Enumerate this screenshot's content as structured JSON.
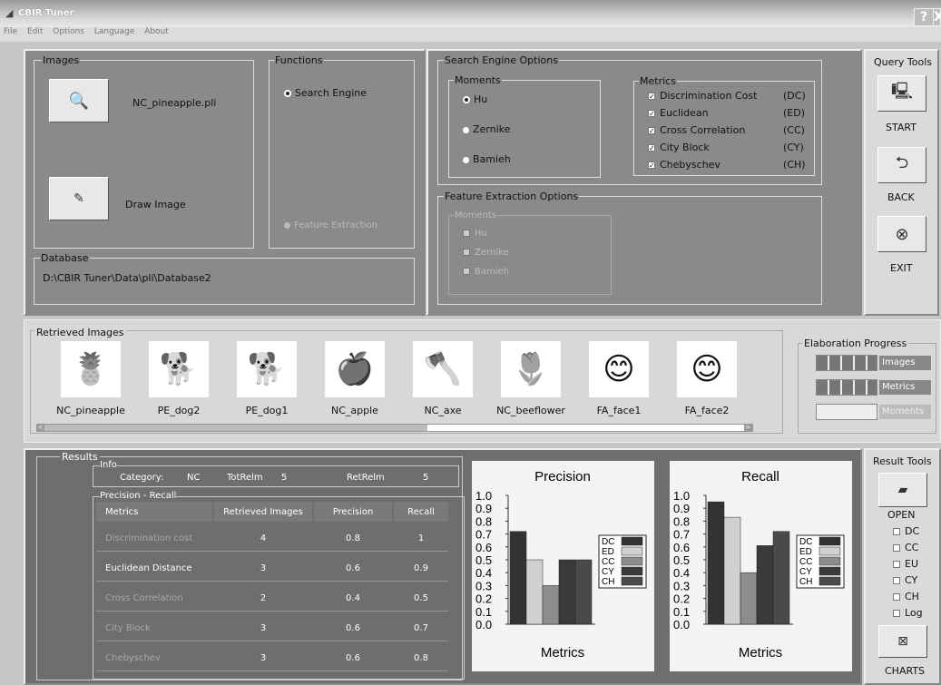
{
  "window": {
    "title": "CBIR Tuner",
    "help_label": "?",
    "close_label": "X"
  },
  "menu": [
    "File",
    "Edit",
    "Options",
    "Language",
    "About"
  ],
  "images_panel": {
    "title": "Images",
    "file_name": "NC_pineapple.pli",
    "draw_label": "Draw Image"
  },
  "functions_panel": {
    "title": "Functions",
    "search_engine": "Search Engine",
    "feature_extraction": "Feature Extraction"
  },
  "database": {
    "title": "Database",
    "path": "D:\\CBIR Tuner\\Data\\pli\\Database2"
  },
  "search_options": {
    "title": "Search Engine Options",
    "moments_title": "Moments",
    "moments": [
      "Hu",
      "Zernike",
      "Bamieh"
    ],
    "metrics_title": "Metrics",
    "metrics": [
      {
        "label": "Discrimination Cost",
        "code": "(DC)"
      },
      {
        "label": "Euclidean",
        "code": "(ED)"
      },
      {
        "label": "Cross Correlation",
        "code": "(CC)"
      },
      {
        "label": "City Block",
        "code": "(CY)"
      },
      {
        "label": "Chebyschev",
        "code": "(CH)"
      }
    ]
  },
  "feature_options": {
    "title": "Feature Extraction Options",
    "moments_title": "Moments",
    "moments": [
      "Hu",
      "Zernike",
      "Bamieh"
    ]
  },
  "query_tools": {
    "title": "Query Tools",
    "start": "START",
    "back": "BACK",
    "exit": "EXIT"
  },
  "retrieved": {
    "title": "Retrieved Images",
    "items": [
      "NC_pineapple",
      "PE_dog2",
      "PE_dog1",
      "NC_apple",
      "NC_axe",
      "NC_beeflower",
      "FA_face1",
      "FA_face2"
    ],
    "scroll_left": "<",
    "scroll_right": ">"
  },
  "progress": {
    "title": "Elaboration Progress",
    "items": [
      {
        "label": "Images",
        "value": 1.0
      },
      {
        "label": "Metrics",
        "value": 1.0
      },
      {
        "label": "Moments",
        "value": 0.0
      }
    ]
  },
  "results": {
    "title": "Results",
    "info_title": "Info",
    "category_label": "Category:",
    "category_value": "NC",
    "totrelm_label": "TotRelm",
    "totrelm_value": "5",
    "retrelm_label": "RetRelm",
    "retrelm_value": "5",
    "pr_title": "Precision - Recall",
    "headers": [
      "Metrics",
      "Retrieved Images",
      "Precision",
      "Recall"
    ],
    "rows": [
      [
        "Discrimination cost",
        "4",
        "0.8",
        "1"
      ],
      [
        "Euclidean Distance",
        "3",
        "0.6",
        "0.9"
      ],
      [
        "Cross Correlation",
        "2",
        "0.4",
        "0.5"
      ],
      [
        "City Block",
        "3",
        "0.6",
        "0.7"
      ],
      [
        "Chebyschev",
        "3",
        "0.6",
        "0.8"
      ]
    ]
  },
  "chart_data": [
    {
      "type": "bar",
      "title": "Precision",
      "xlabel": "Metrics",
      "ylim": [
        0,
        1.0
      ],
      "yticks": [
        "1.0",
        "0.9",
        "0.8",
        "0.7",
        "0.6",
        "0.5",
        "0.4",
        "0.3",
        "0.2",
        "0.1",
        "0.0"
      ],
      "categories": [
        "DC",
        "ED",
        "CC",
        "CY",
        "CH"
      ],
      "values": [
        0.72,
        0.5,
        0.3,
        0.5,
        0.5
      ],
      "colors": [
        "#333333",
        "#d0d0d0",
        "#8c8c8c",
        "#3a3a3a",
        "#4a4a4a"
      ]
    },
    {
      "type": "bar",
      "title": "Recall",
      "xlabel": "Metrics",
      "ylim": [
        0,
        1.0
      ],
      "yticks": [
        "1.0",
        "0.9",
        "0.8",
        "0.7",
        "0.6",
        "0.5",
        "0.4",
        "0.3",
        "0.2",
        "0.1",
        "0.0"
      ],
      "categories": [
        "DC",
        "ED",
        "CC",
        "CY",
        "CH"
      ],
      "values": [
        0.95,
        0.83,
        0.4,
        0.61,
        0.72
      ],
      "colors": [
        "#333333",
        "#d0d0d0",
        "#8c8c8c",
        "#3a3a3a",
        "#4a4a4a"
      ]
    }
  ],
  "result_tools": {
    "title": "Result Tools",
    "open": "OPEN",
    "checks": [
      "DC",
      "CC",
      "EU",
      "CY",
      "CH",
      "Log"
    ],
    "charts": "CHARTS"
  }
}
